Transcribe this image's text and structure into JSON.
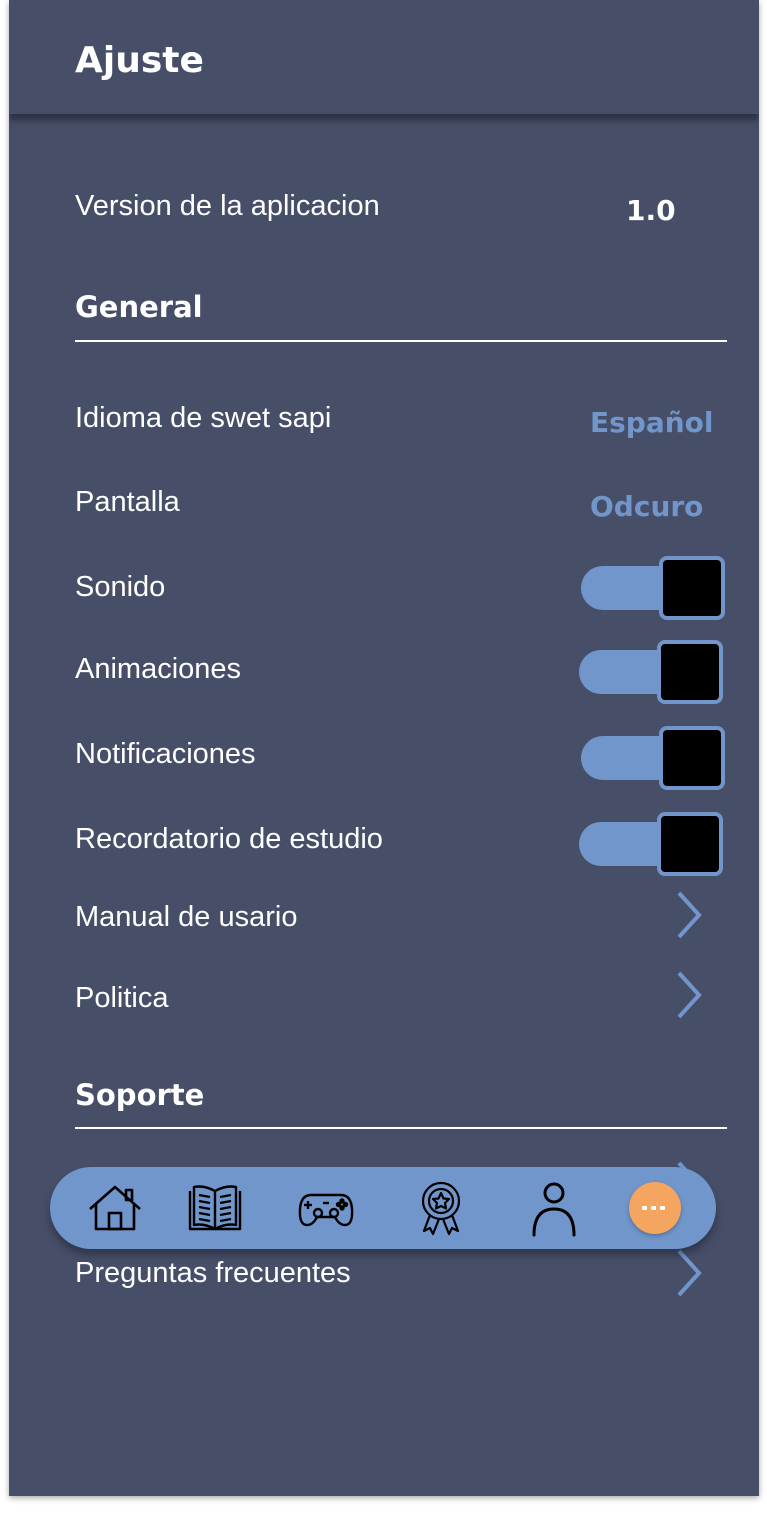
{
  "header": {
    "title": "Ajuste"
  },
  "app_version": {
    "label": "Version de la aplicacion",
    "value": "1.0"
  },
  "general": {
    "title": "General",
    "language": {
      "label": "Idioma de swet sapi",
      "value": "Español"
    },
    "screen": {
      "label": "Pantalla",
      "value": "Odcuro"
    },
    "toggles": [
      {
        "label": "Sonido",
        "on": true
      },
      {
        "label": "Animaciones",
        "on": true
      },
      {
        "label": "Notificaciones",
        "on": true
      },
      {
        "label": "Recordatorio de estudio",
        "on": true
      }
    ],
    "links": [
      {
        "label": "Manual de usario"
      },
      {
        "label": "Politica"
      }
    ]
  },
  "support": {
    "title": "Soporte",
    "links": [
      {
        "label": "Preguntas frecuentes"
      }
    ]
  },
  "bottom_nav": {
    "items": [
      "home-icon",
      "book-icon",
      "gamepad-icon",
      "award-badge-icon",
      "user-icon",
      "more-icon"
    ],
    "active": "more-icon"
  },
  "colors": {
    "background": "#474f68",
    "accent": "#7196cb",
    "active": "#f4a55f",
    "text": "#ffffff"
  }
}
